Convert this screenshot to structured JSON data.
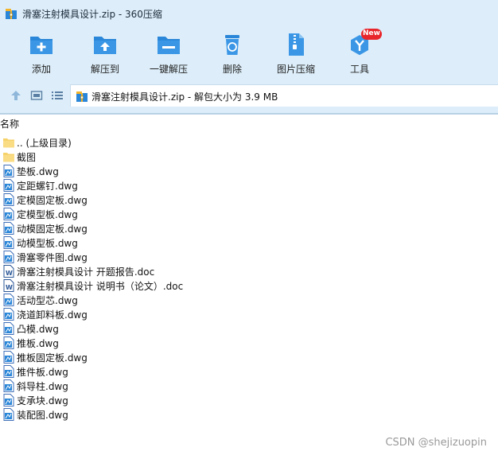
{
  "window": {
    "title": "滑塞注射模具设计.zip - 360压缩"
  },
  "toolbar": {
    "items": [
      {
        "label": "添加",
        "icon": "add-icon"
      },
      {
        "label": "解压到",
        "icon": "extract-to-icon"
      },
      {
        "label": "一键解压",
        "icon": "one-click-extract-icon"
      },
      {
        "label": "删除",
        "icon": "delete-icon"
      },
      {
        "label": "图片压缩",
        "icon": "image-compress-icon"
      },
      {
        "label": "工具",
        "icon": "tools-icon",
        "badge": "New"
      }
    ]
  },
  "address": {
    "text": "滑塞注射模具设计.zip - 解包大小为 3.9 MB"
  },
  "list": {
    "column_name": "名称",
    "items": [
      {
        "name": ".. (上级目录)",
        "type": "folder"
      },
      {
        "name": "截图",
        "type": "folder"
      },
      {
        "name": "垫板.dwg",
        "type": "dwg"
      },
      {
        "name": "定距螺钉.dwg",
        "type": "dwg"
      },
      {
        "name": "定模固定板.dwg",
        "type": "dwg"
      },
      {
        "name": "定模型板.dwg",
        "type": "dwg"
      },
      {
        "name": "动模固定板.dwg",
        "type": "dwg"
      },
      {
        "name": "动模型板.dwg",
        "type": "dwg"
      },
      {
        "name": "滑塞零件图.dwg",
        "type": "dwg"
      },
      {
        "name": "滑塞注射模具设计 开题报告.doc",
        "type": "doc"
      },
      {
        "name": "滑塞注射模具设计 说明书（论文）.doc",
        "type": "doc"
      },
      {
        "name": "活动型芯.dwg",
        "type": "dwg"
      },
      {
        "name": "浇道卸料板.dwg",
        "type": "dwg"
      },
      {
        "name": "凸模.dwg",
        "type": "dwg"
      },
      {
        "name": "推板.dwg",
        "type": "dwg"
      },
      {
        "name": "推板固定板.dwg",
        "type": "dwg"
      },
      {
        "name": "推件板.dwg",
        "type": "dwg"
      },
      {
        "name": "斜导柱.dwg",
        "type": "dwg"
      },
      {
        "name": "支承块.dwg",
        "type": "dwg"
      },
      {
        "name": "装配图.dwg",
        "type": "dwg"
      }
    ]
  },
  "watermark": "CSDN @shejizuopin",
  "colors": {
    "chrome_bg": "#ddeefa",
    "icon_blue": "#2a86d8",
    "badge_red": "#e8252b",
    "folder_yellow": "#f6d26a"
  }
}
